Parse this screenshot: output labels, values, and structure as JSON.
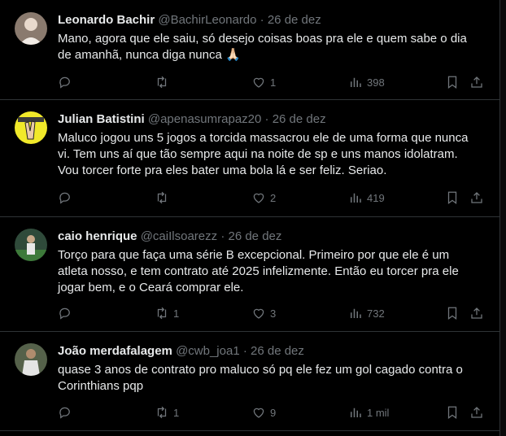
{
  "tweets": [
    {
      "name": "Leonardo Bachir",
      "handle": "@BachirLeonardo",
      "date": "26 de dez",
      "text": "Mano, agora que ele saiu, só desejo coisas boas pra ele e quem sabe o dia de amanhã, nunca diga nunca 🙏🏻",
      "replies": "",
      "retweets": "",
      "likes": "1",
      "views": "398"
    },
    {
      "name": "Julian Batistini",
      "handle": "@apenasumrapaz20",
      "date": "26 de dez",
      "text": "Maluco jogou uns 5 jogos a torcida massacrou ele de uma forma que nunca vi. Tem uns aí que tão sempre aqui na noite de sp e uns manos idolatram. Vou torcer forte pra eles bater uma bola lá e ser feliz. Seriao.",
      "replies": "",
      "retweets": "",
      "likes": "2",
      "views": "419"
    },
    {
      "name": "caio henrique",
      "handle": "@caiIlsoarezz",
      "date": "26 de dez",
      "text": "Torço para que faça uma série B excepcional. Primeiro por que ele é um atleta nosso, e tem contrato até 2025 infelizmente. Então eu torcer pra ele jogar bem, e o Ceará comprar ele.",
      "replies": "",
      "retweets": "1",
      "likes": "3",
      "views": "732"
    },
    {
      "name": "João merdafalagem",
      "handle": "@cwb_joa1",
      "date": "26 de dez",
      "text": "quase 3 anos de contrato pro maluco só pq ele fez um gol cagado contra o Corinthians pqp",
      "replies": "",
      "retweets": "1",
      "likes": "9",
      "views": "1 mil"
    }
  ],
  "separator": "·",
  "colors": {
    "background": "#000000",
    "text": "#e7e9ea",
    "secondary": "#71767b",
    "border": "#2f3336"
  },
  "icons": [
    "reply-icon",
    "retweet-icon",
    "like-icon",
    "views-icon",
    "bookmark-icon",
    "share-icon"
  ]
}
